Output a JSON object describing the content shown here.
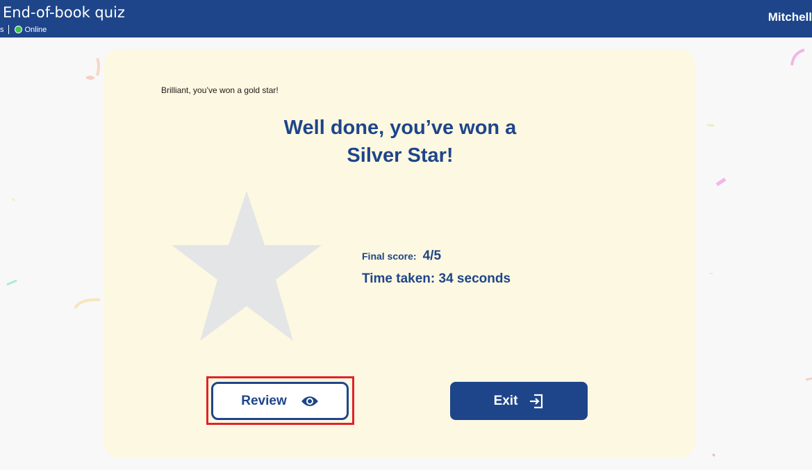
{
  "header": {
    "title": "End-of-book quiz",
    "cut_text": "s",
    "status": "Online",
    "user_name": "Mitchell"
  },
  "result": {
    "small_message": "Brilliant, you’ve won a gold star!",
    "headline_line1": "Well done, you’ve won a",
    "headline_line2": "Silver Star!",
    "score_label": "Final score:",
    "score_value": "4/5",
    "time_text": "Time taken: 34 seconds"
  },
  "buttons": {
    "review_label": "Review",
    "exit_label": "Exit"
  },
  "icons": {
    "review": "eye-icon",
    "exit": "exit-icon",
    "star": "star-icon",
    "status": "online-dot-icon"
  },
  "colors": {
    "brand": "#1e4589",
    "card_bg": "#fdf8e1",
    "star_fill": "#e4e5e7",
    "online": "#3ec24a",
    "highlight": "#e0222a"
  }
}
